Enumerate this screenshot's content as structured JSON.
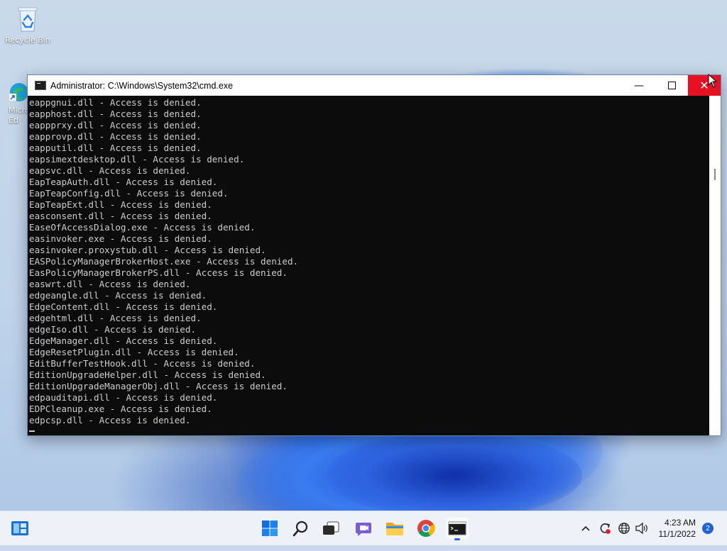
{
  "desktop": {
    "icons": [
      {
        "label": "Recycle Bin",
        "icon": "recycle-bin-icon"
      },
      {
        "label": "Micro\nEd",
        "icon": "edge-icon"
      }
    ]
  },
  "window": {
    "title": "Administrator:  C:\\Windows\\System32\\cmd.exe",
    "minimize": "—",
    "close": "✕"
  },
  "console": {
    "lines": [
      "eappgnui.dll - Access is denied.",
      "eapphost.dll - Access is denied.",
      "eappprxy.dll - Access is denied.",
      "eapprovp.dll - Access is denied.",
      "eapputil.dll - Access is denied.",
      "eapsimextdesktop.dll - Access is denied.",
      "eapsvc.dll - Access is denied.",
      "EapTeapAuth.dll - Access is denied.",
      "EapTeapConfig.dll - Access is denied.",
      "EapTeapExt.dll - Access is denied.",
      "easconsent.dll - Access is denied.",
      "EaseOfAccessDialog.exe - Access is denied.",
      "easinvoker.exe - Access is denied.",
      "easinvoker.proxystub.dll - Access is denied.",
      "EASPolicyManagerBrokerHost.exe - Access is denied.",
      "EasPolicyManagerBrokerPS.dll - Access is denied.",
      "easwrt.dll - Access is denied.",
      "edgeangle.dll - Access is denied.",
      "EdgeContent.dll - Access is denied.",
      "edgehtml.dll - Access is denied.",
      "edgeIso.dll - Access is denied.",
      "EdgeManager.dll - Access is denied.",
      "EdgeResetPlugin.dll - Access is denied.",
      "EditBufferTestHook.dll - Access is denied.",
      "EditionUpgradeHelper.dll - Access is denied.",
      "EditionUpgradeManagerObj.dll - Access is denied.",
      "edpauditapi.dll - Access is denied.",
      "EDPCleanup.exe - Access is denied.",
      "edpcsp.dll - Access is denied."
    ]
  },
  "taskbar": {
    "apps": [
      {
        "name": "widgets-icon"
      },
      {
        "name": "start-icon"
      },
      {
        "name": "search-icon"
      },
      {
        "name": "task-view-icon"
      },
      {
        "name": "chat-icon"
      },
      {
        "name": "file-explorer-icon"
      },
      {
        "name": "chrome-icon"
      },
      {
        "name": "terminal-icon"
      }
    ],
    "tray_chevron": "^",
    "time": "4:23 AM",
    "date": "11/1/2022",
    "notifications": "2",
    "accent": "#1e63d6"
  }
}
